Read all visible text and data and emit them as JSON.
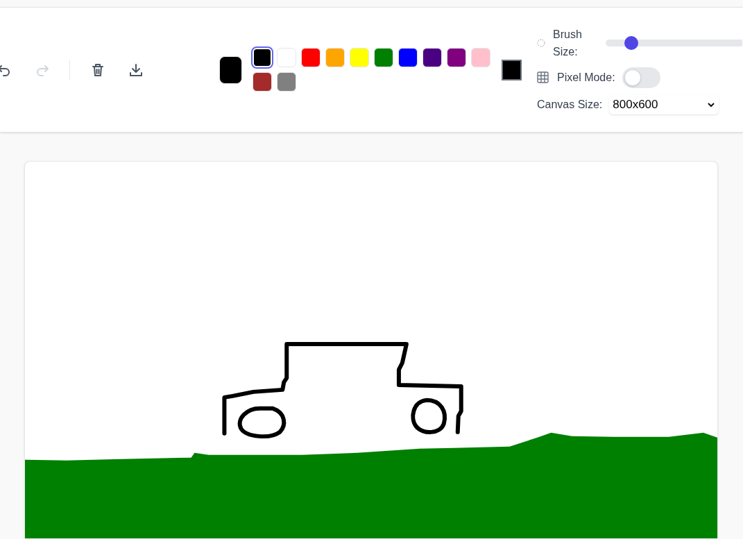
{
  "toolbar": {
    "actions": [
      {
        "kind": "undo",
        "disabled": false
      },
      {
        "kind": "redo",
        "disabled": true
      },
      {
        "kind": "divider"
      },
      {
        "kind": "clear",
        "disabled": false
      },
      {
        "kind": "download",
        "disabled": false
      }
    ],
    "palette": [
      {
        "color": "#000000",
        "selected": true
      },
      {
        "color": "#ffffff",
        "selected": false
      },
      {
        "color": "#ff0000",
        "selected": false
      },
      {
        "color": "#ffa500",
        "selected": false
      },
      {
        "color": "#ffff00",
        "selected": false
      },
      {
        "color": "#008000",
        "selected": false
      },
      {
        "color": "#0000ff",
        "selected": false
      },
      {
        "color": "#4b0082",
        "selected": false
      },
      {
        "color": "#800080",
        "selected": false
      },
      {
        "color": "#ffc0cb",
        "selected": false
      },
      {
        "color": "#a52a2a",
        "selected": false
      },
      {
        "color": "#808080",
        "selected": false
      }
    ],
    "brush_size": {
      "label": "Brush Size:",
      "level": 0.19
    },
    "pixel_mode": {
      "label": "Pixel Mode:",
      "on": false
    },
    "canvas_size": {
      "label": "Canvas Size:",
      "value": "800x600"
    }
  }
}
